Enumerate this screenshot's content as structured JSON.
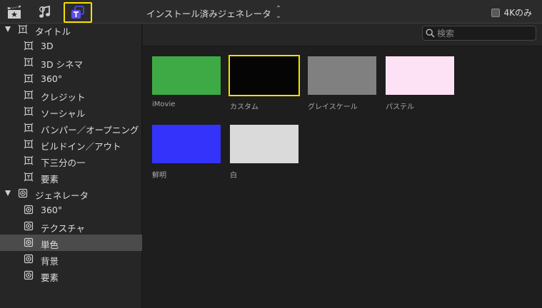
{
  "toolbar": {
    "icons": [
      "clapper-star-icon",
      "music-note-icon",
      "titles-generators-icon"
    ],
    "active_icon": "titles-generators-icon",
    "title": "インストール済みジェネレータ",
    "filter_4k_label": "4Kのみ",
    "filter_4k_checked": false
  },
  "sidebar": {
    "groups": [
      {
        "label": "タイトル",
        "icon": "titles-icon",
        "expanded": true,
        "items": [
          "3D",
          "3D シネマ",
          "360°",
          "クレジット",
          "ソーシャル",
          "バンパー／オープニング",
          "ビルドイン／アウト",
          "下三分の一",
          "要素"
        ]
      },
      {
        "label": "ジェネレータ",
        "icon": "generator-icon",
        "expanded": true,
        "items": [
          "360°",
          "テクスチャ",
          "単色",
          "背景",
          "要素"
        ]
      }
    ],
    "selected": "単色"
  },
  "search": {
    "placeholder": "検索",
    "value": ""
  },
  "tiles": [
    {
      "label": "iMovie",
      "color": "#3daa46",
      "selected": false
    },
    {
      "label": "カスタム",
      "color": "#050505",
      "selected": true
    },
    {
      "label": "グレイスケール",
      "color": "#808080",
      "selected": false
    },
    {
      "label": "パステル",
      "color": "#fde2f6",
      "selected": false
    },
    {
      "label": "鮮明",
      "color": "#3333fb",
      "selected": false
    },
    {
      "label": "白",
      "color": "#dadada",
      "selected": false
    }
  ],
  "colors": {
    "accent": "#f6e000",
    "active_icon": "#5b4cf0"
  }
}
